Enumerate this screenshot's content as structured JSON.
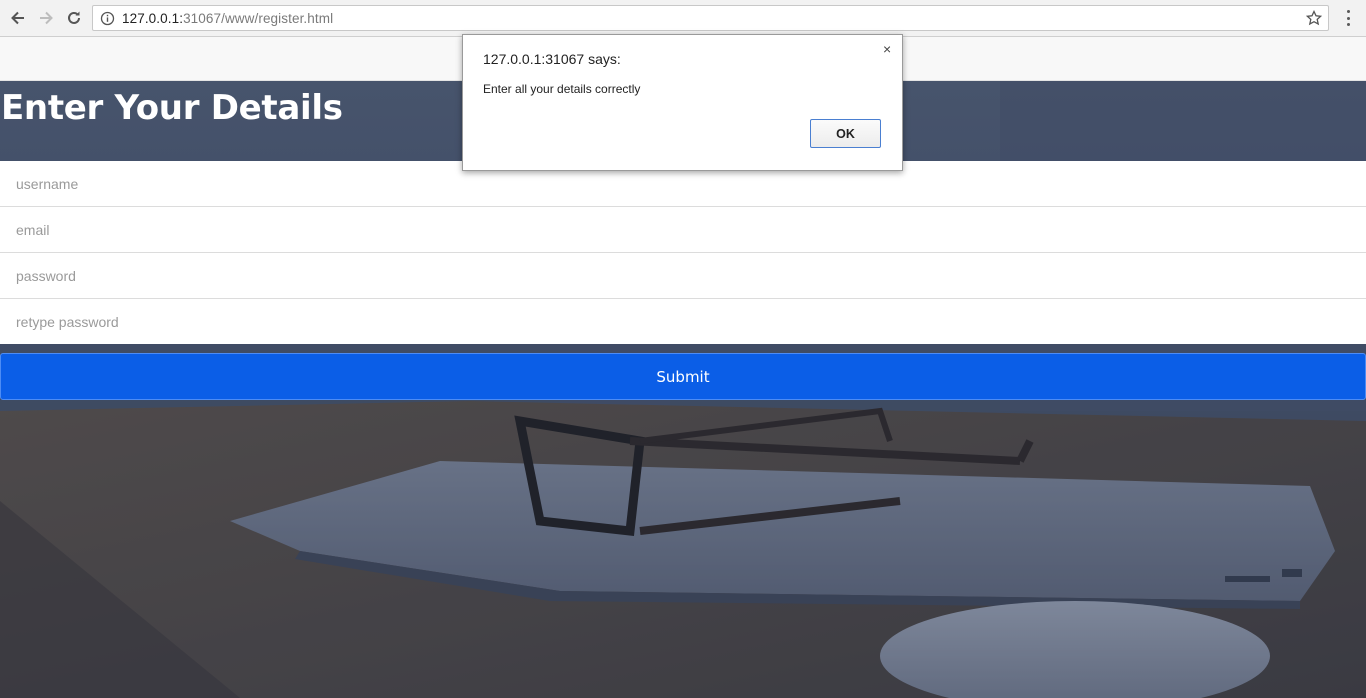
{
  "browser": {
    "url_host": "127.0.0.1:",
    "url_rest": "31067/www/register.html",
    "icons": [
      "back-arrow-icon",
      "forward-arrow-icon",
      "reload-icon",
      "info-icon",
      "star-icon",
      "menu-dots-icon"
    ]
  },
  "page": {
    "heading": "Enter Your Details",
    "fields": [
      {
        "placeholder": "username",
        "value": ""
      },
      {
        "placeholder": "email",
        "value": ""
      },
      {
        "placeholder": "password",
        "value": ""
      },
      {
        "placeholder": "retype password",
        "value": ""
      }
    ],
    "submit_label": "Submit",
    "accent_color": "#0b5ee7"
  },
  "dialog": {
    "title": "127.0.0.1:31067 says:",
    "message": "Enter all your details correctly",
    "ok_label": "OK",
    "close_glyph": "×"
  }
}
